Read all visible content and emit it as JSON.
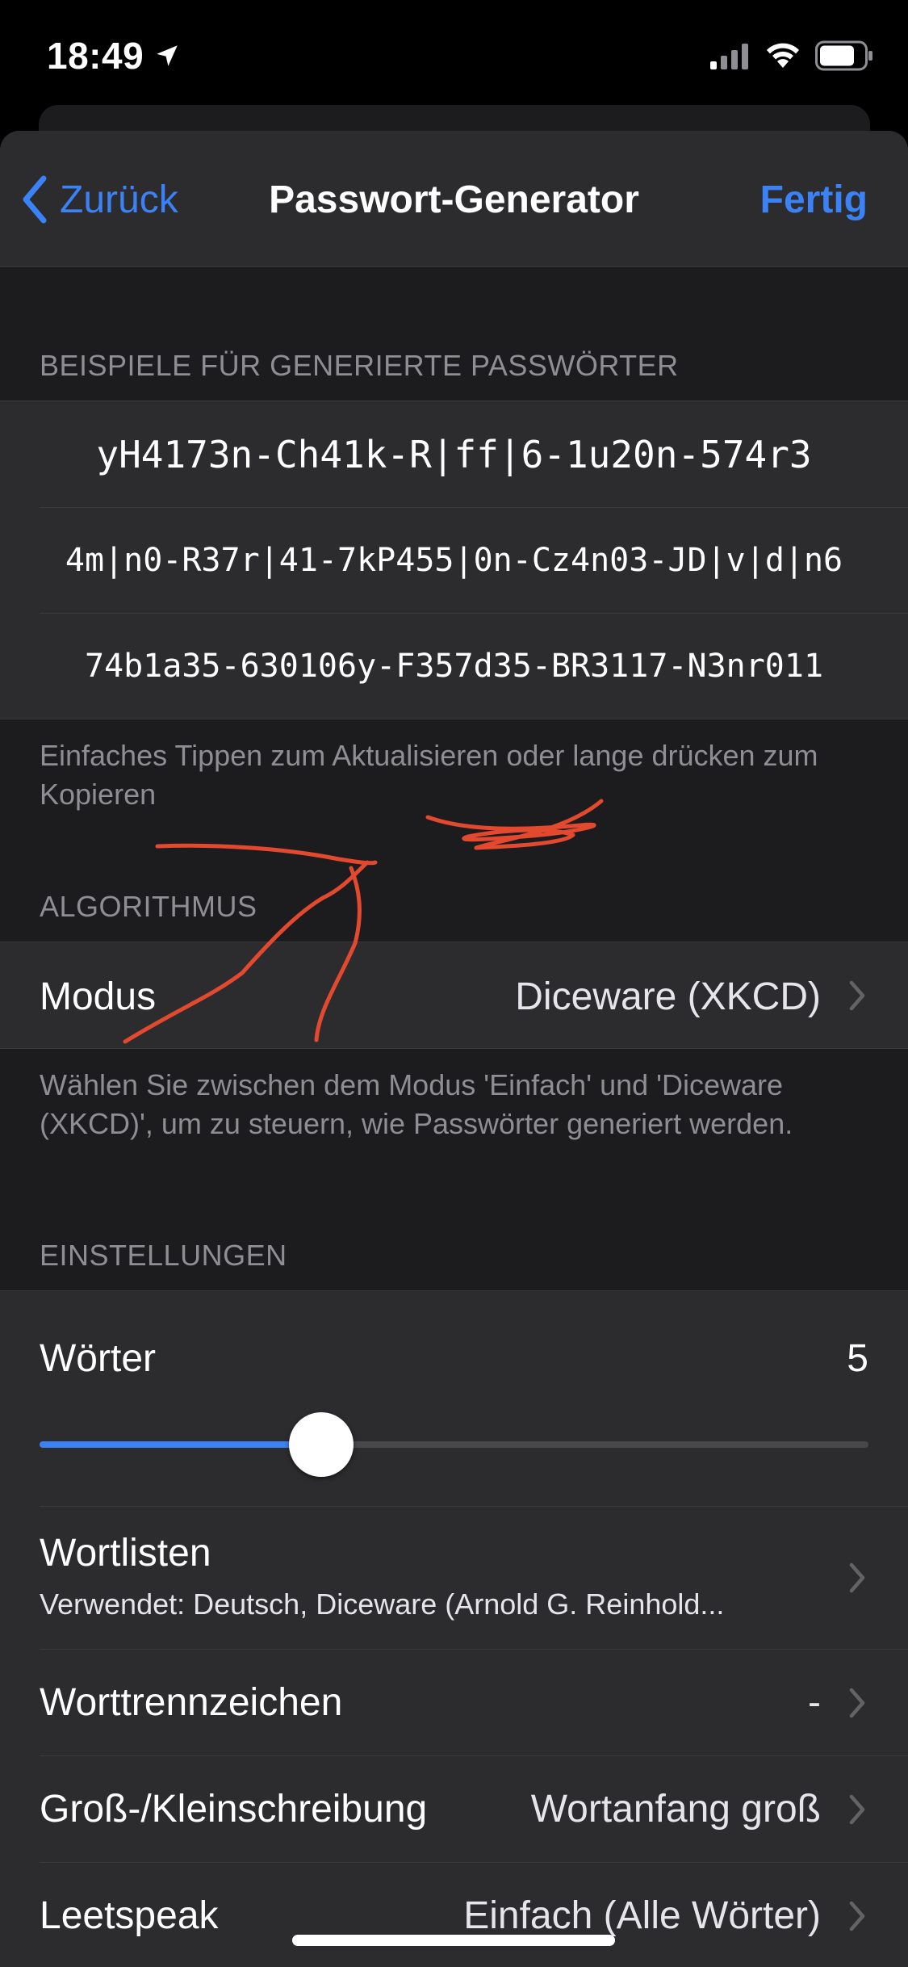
{
  "status_bar": {
    "time": "18:49",
    "location_icon": "location-arrow-icon",
    "signal_icon": "cellular-signal-icon",
    "wifi_icon": "wifi-icon",
    "battery_icon": "battery-icon"
  },
  "nav": {
    "back_label": "Zurück",
    "title": "Passwort-Generator",
    "done_label": "Fertig"
  },
  "examples": {
    "header": "BEISPIELE FÜR GENERIERTE PASSWÖRTER",
    "passwords": [
      "yH4173n-Ch41k-R|ff|6-1u20n-574r3",
      "4m|n0-R37r|41-7kP455|0n-Cz4n03-JD|v|d|n6",
      "74b1a35-630106y-F357d35-BR3117-N3nr011"
    ],
    "footer": "Einfaches Tippen zum Aktualisieren oder lange drücken zum Kopieren"
  },
  "algorithm": {
    "header": "ALGORITHMUS",
    "mode_label": "Modus",
    "mode_value": "Diceware (XKCD)",
    "footer": "Wählen Sie zwischen dem Modus 'Einfach' und 'Diceware (XKCD)', um zu steuern, wie Passwörter generiert werden."
  },
  "settings": {
    "header": "EINSTELLUNGEN",
    "words_label": "Wörter",
    "words_value": "5",
    "words_slider_fraction": 0.34,
    "wordlists_label": "Wortlisten",
    "wordlists_subtitle": "Verwendet: Deutsch, Diceware (Arnold G. Reinhold...",
    "separator_label": "Worttrennzeichen",
    "separator_value": "-",
    "case_label": "Groß-/Kleinschreibung",
    "case_value": "Wortanfang groß",
    "leet_label": "Leetspeak",
    "leet_value": "Einfach (Alle Wörter)"
  },
  "colors": {
    "accent": "#3b82f6",
    "background": "#1c1c1e",
    "cell": "#2c2c2e",
    "secondary_text": "#8e8e93",
    "annotation": "#e2492f"
  }
}
